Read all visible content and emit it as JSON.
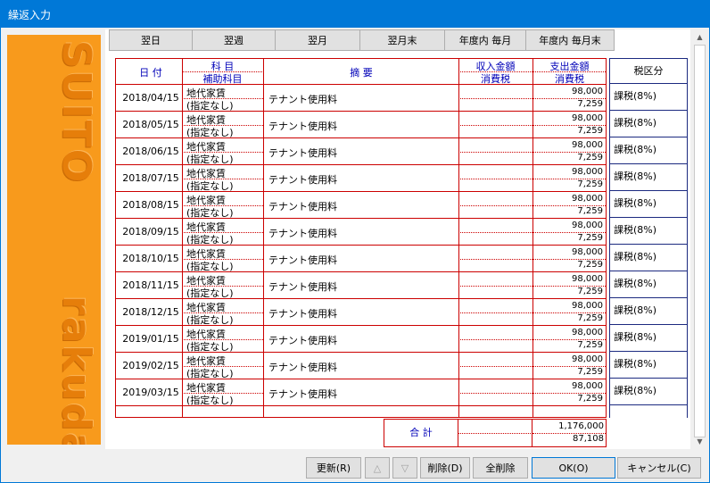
{
  "window": {
    "title": "繰返入力"
  },
  "brand": {
    "word1": "SUITO",
    "word2": "rakuda"
  },
  "nav": [
    "翌日",
    "翌週",
    "翌月",
    "翌月末",
    "年度内 毎月",
    "年度内 毎月末"
  ],
  "headers": {
    "date": "日 付",
    "account": "科 目",
    "sub_account": "補助科目",
    "description": "摘 要",
    "income": "収入金額",
    "income_tax": "消費税",
    "expense": "支出金額",
    "expense_tax": "消費税",
    "tax_class": "税区分"
  },
  "rows": [
    {
      "date": "2018/04/15",
      "account": "地代家賃",
      "sub": "(指定なし)",
      "desc": "テナント使用料",
      "amount": "98,000",
      "tax": "7,259",
      "tax_class": "課税(8%)"
    },
    {
      "date": "2018/05/15",
      "account": "地代家賃",
      "sub": "(指定なし)",
      "desc": "テナント使用料",
      "amount": "98,000",
      "tax": "7,259",
      "tax_class": "課税(8%)"
    },
    {
      "date": "2018/06/15",
      "account": "地代家賃",
      "sub": "(指定なし)",
      "desc": "テナント使用料",
      "amount": "98,000",
      "tax": "7,259",
      "tax_class": "課税(8%)"
    },
    {
      "date": "2018/07/15",
      "account": "地代家賃",
      "sub": "(指定なし)",
      "desc": "テナント使用料",
      "amount": "98,000",
      "tax": "7,259",
      "tax_class": "課税(8%)"
    },
    {
      "date": "2018/08/15",
      "account": "地代家賃",
      "sub": "(指定なし)",
      "desc": "テナント使用料",
      "amount": "98,000",
      "tax": "7,259",
      "tax_class": "課税(8%)"
    },
    {
      "date": "2018/09/15",
      "account": "地代家賃",
      "sub": "(指定なし)",
      "desc": "テナント使用料",
      "amount": "98,000",
      "tax": "7,259",
      "tax_class": "課税(8%)"
    },
    {
      "date": "2018/10/15",
      "account": "地代家賃",
      "sub": "(指定なし)",
      "desc": "テナント使用料",
      "amount": "98,000",
      "tax": "7,259",
      "tax_class": "課税(8%)"
    },
    {
      "date": "2018/11/15",
      "account": "地代家賃",
      "sub": "(指定なし)",
      "desc": "テナント使用料",
      "amount": "98,000",
      "tax": "7,259",
      "tax_class": "課税(8%)"
    },
    {
      "date": "2018/12/15",
      "account": "地代家賃",
      "sub": "(指定なし)",
      "desc": "テナント使用料",
      "amount": "98,000",
      "tax": "7,259",
      "tax_class": "課税(8%)"
    },
    {
      "date": "2019/01/15",
      "account": "地代家賃",
      "sub": "(指定なし)",
      "desc": "テナント使用料",
      "amount": "98,000",
      "tax": "7,259",
      "tax_class": "課税(8%)"
    },
    {
      "date": "2019/02/15",
      "account": "地代家賃",
      "sub": "(指定なし)",
      "desc": "テナント使用料",
      "amount": "98,000",
      "tax": "7,259",
      "tax_class": "課税(8%)"
    },
    {
      "date": "2019/03/15",
      "account": "地代家賃",
      "sub": "(指定なし)",
      "desc": "テナント使用料",
      "amount": "98,000",
      "tax": "7,259",
      "tax_class": "課税(8%)"
    }
  ],
  "totals": {
    "label": "合 計",
    "amount": "1,176,000",
    "tax": "87,108"
  },
  "buttons": {
    "update": "更新(R)",
    "up": "△",
    "down": "▽",
    "delete": "削除(D)",
    "delete_all": "全削除",
    "ok": "OK(O)",
    "cancel": "キャンセル(C)"
  },
  "scroll": {
    "up": "▲",
    "down": "▼"
  }
}
